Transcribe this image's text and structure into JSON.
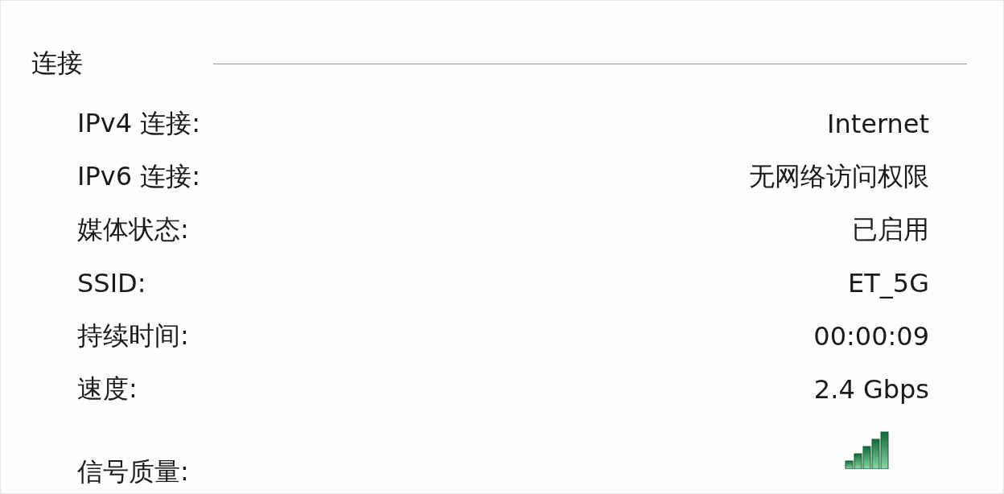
{
  "section": {
    "title": "连接"
  },
  "rows": [
    {
      "label": "IPv4 连接:",
      "kind": "text",
      "value": "Internet"
    },
    {
      "label": "IPv6 连接:",
      "kind": "text",
      "value": "无网络访问权限"
    },
    {
      "label": "媒体状态:",
      "kind": "text",
      "value": "已启用"
    },
    {
      "label": "SSID:",
      "kind": "text",
      "value": "ET_5G"
    },
    {
      "label": "持续时间:",
      "kind": "text",
      "value": "00:00:09"
    },
    {
      "label": "速度:",
      "kind": "text",
      "value": "2.4 Gbps"
    },
    {
      "label": "信号质量:",
      "kind": "signal"
    }
  ]
}
